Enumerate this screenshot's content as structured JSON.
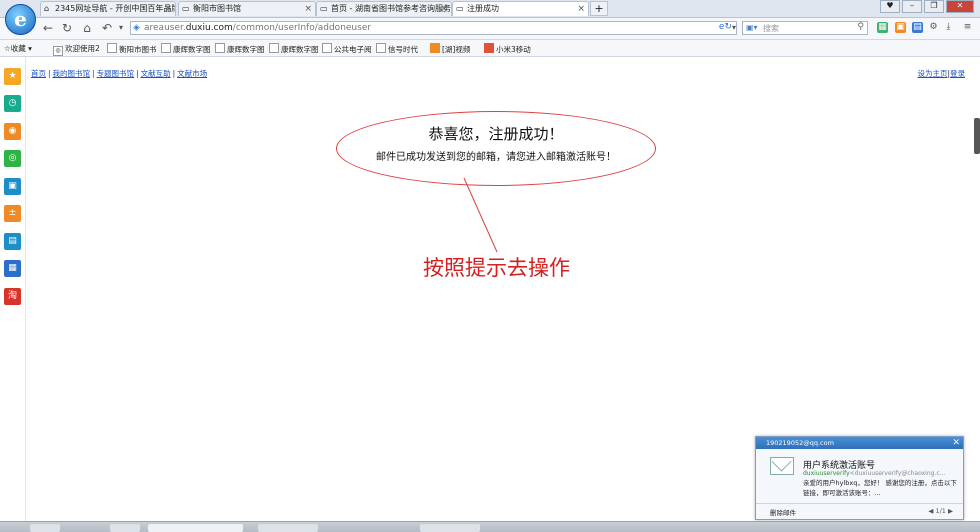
{
  "tabs": [
    {
      "label": "2345网址导航 - 开创中国百年品牌",
      "icon": "home-icon",
      "active": false
    },
    {
      "label": "衡阳市图书馆",
      "icon": "page-icon",
      "active": false
    },
    {
      "label": "首页 - 湖南省图书馆参考咨询服务",
      "icon": "page-icon",
      "active": false
    },
    {
      "label": "注册成功",
      "icon": "page-icon",
      "active": true
    }
  ],
  "address": {
    "url_prefix": "areauser.",
    "url_domain": "duxiu.com",
    "url_path": "/common/userInfo/addoneuser",
    "search_placeholder": "搜索"
  },
  "bookmarks": {
    "label": "收藏",
    "items": [
      "欢迎使用2",
      "衡阳市图书",
      "康辉数字图",
      "康辉数字图",
      "康辉数字图",
      "公共电子阅",
      "信号时代",
      "[湖]视频",
      "小米3移动"
    ]
  },
  "page": {
    "nav_links": [
      "首页",
      "我的图书馆",
      "专题图书馆",
      "文献互助",
      "文献市场"
    ],
    "nav_sep": "|",
    "right_links": [
      "设为主页",
      "登录"
    ],
    "congrats": "恭喜您，注册成功！",
    "subline": "邮件已成功发送到您的邮箱，请您进入邮箱激活账号！",
    "annotation": "按照提示去操作"
  },
  "notification": {
    "account": "190219052@qq.com",
    "title": "用户系统激活账号",
    "sender_name": "duxiuuserverify",
    "sender_addr": "<duxiuuserverify@chaoxing.c...",
    "body": "亲爱的用户hylbxq，您好！ 感谢您的注册，点击以下链接，即可激活该账号：...",
    "delete_label": "删除邮件",
    "pager": "1/1"
  },
  "colors": {
    "accent_red": "#d42020",
    "link_blue": "#1a4fc4"
  }
}
